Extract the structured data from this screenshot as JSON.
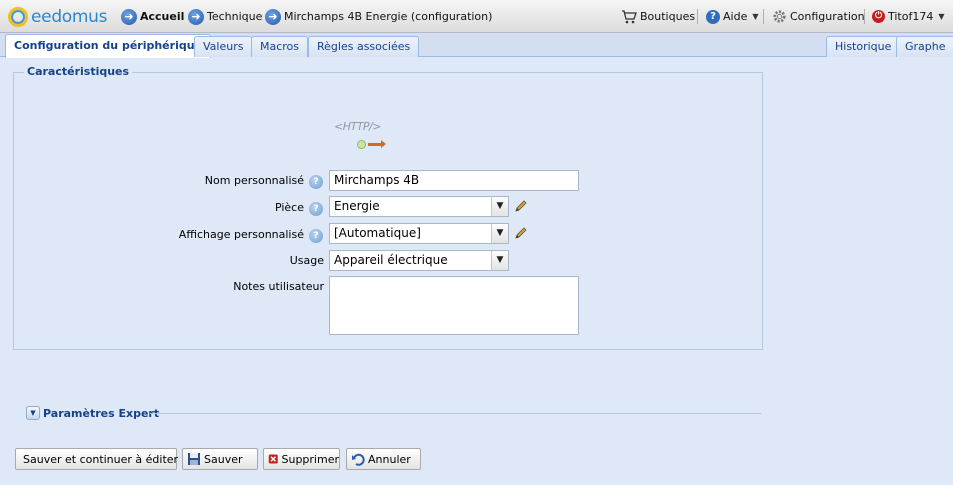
{
  "topbar": {
    "logo_text": "eedomus",
    "crumbs": [
      {
        "label": "Accueil"
      },
      {
        "label": "Technique"
      },
      {
        "label": "Mirchamps 4B Energie (configuration)"
      }
    ],
    "boutiques": "Boutiques",
    "aide": "Aide",
    "configuration": "Configuration",
    "user": "Titof174"
  },
  "tabs": {
    "left": [
      "Configuration du périphérique",
      "Valeurs",
      "Macros",
      "Règles associées"
    ],
    "right": [
      "Historique",
      "Graphe"
    ]
  },
  "section": {
    "title": "Caractéristiques",
    "logo_text": "<HTTP/>"
  },
  "form": {
    "name_label": "Nom personnalisé",
    "name_value": "Mirchamps 4B",
    "room_label": "Pièce",
    "room_value": "Energie",
    "display_label": "Affichage personnalisé",
    "display_value": "[Automatique]",
    "usage_label": "Usage",
    "usage_value": "Appareil électrique",
    "notes_label": "Notes utilisateur",
    "notes_value": ""
  },
  "expert": {
    "label": "Paramètres Expert"
  },
  "buttons": {
    "save_continue": "Sauver et continuer à éditer",
    "save": "Sauver",
    "delete": "Supprimer",
    "cancel": "Annuler"
  },
  "colors": {
    "accent": "#15428b",
    "tab_border": "#99bbe8",
    "background": "#dfe8f6"
  }
}
